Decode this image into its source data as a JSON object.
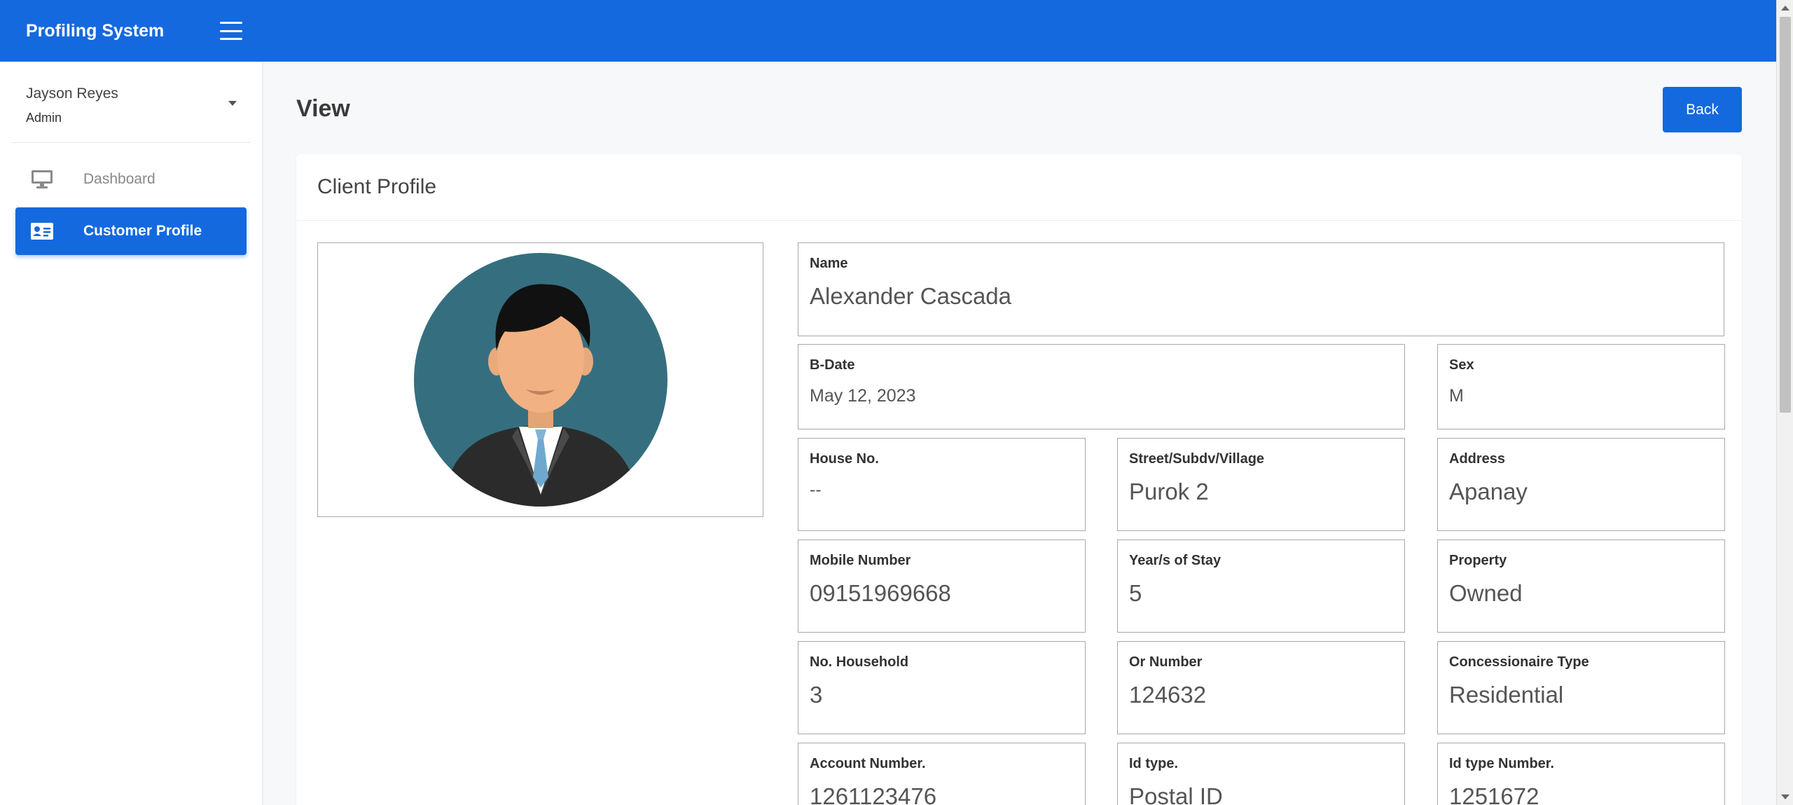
{
  "app": {
    "title": "Profiling System"
  },
  "user": {
    "name": "Jayson Reyes",
    "role": "Admin"
  },
  "nav": [
    {
      "label": "Dashboard",
      "icon": "monitor-icon"
    },
    {
      "label": "Customer Profile",
      "icon": "id-card-icon"
    }
  ],
  "page": {
    "title": "View",
    "back_label": "Back"
  },
  "card": {
    "title": "Client Profile"
  },
  "fields": {
    "name": {
      "label": "Name",
      "value": "Alexander Cascada"
    },
    "bdate": {
      "label": "B-Date",
      "value": "May 12, 2023"
    },
    "sex": {
      "label": "Sex",
      "value": "M"
    },
    "house_no": {
      "label": "House No.",
      "value": "--"
    },
    "street": {
      "label": "Street/Subdv/Village",
      "value": "Purok 2"
    },
    "address": {
      "label": "Address",
      "value": "Apanay"
    },
    "mobile": {
      "label": "Mobile Number",
      "value": "09151969668"
    },
    "years_stay": {
      "label": "Year/s of Stay",
      "value": "5"
    },
    "property": {
      "label": "Property",
      "value": "Owned"
    },
    "household": {
      "label": "No. Household",
      "value": "3"
    },
    "or_number": {
      "label": "Or Number",
      "value": "124632"
    },
    "concessionaire": {
      "label": "Concessionaire Type",
      "value": "Residential"
    },
    "account": {
      "label": "Account Number.",
      "value": "1261123476"
    },
    "id_type": {
      "label": "Id type.",
      "value": "Postal ID"
    },
    "id_number": {
      "label": "Id type Number.",
      "value": "1251672"
    }
  },
  "colors": {
    "primary": "#1469de",
    "avatar_bg": "#356f7f"
  }
}
